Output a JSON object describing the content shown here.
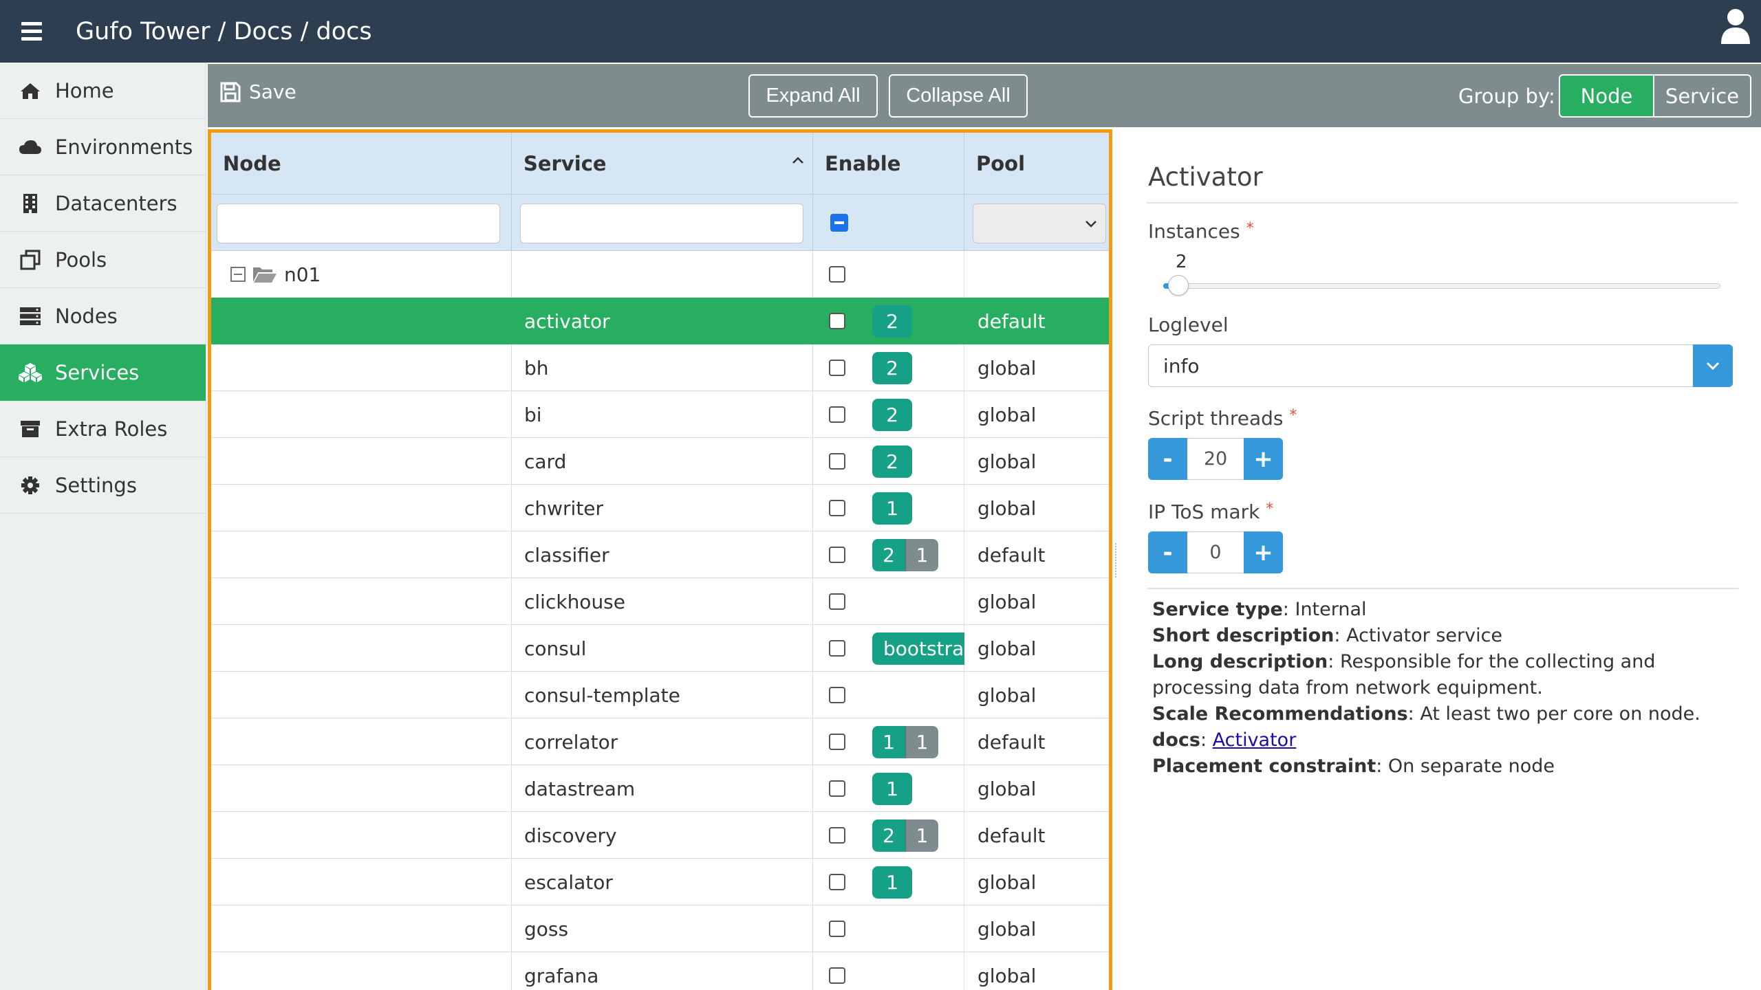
{
  "app": {
    "title": "Gufo Tower / Docs / docs"
  },
  "sidebar": {
    "items": [
      {
        "label": "Home",
        "icon": "home-icon"
      },
      {
        "label": "Environments",
        "icon": "cloud-icon"
      },
      {
        "label": "Datacenters",
        "icon": "building-icon"
      },
      {
        "label": "Pools",
        "icon": "clone-icon"
      },
      {
        "label": "Nodes",
        "icon": "server-icon"
      },
      {
        "label": "Services",
        "icon": "cubes-icon",
        "active": true
      },
      {
        "label": "Extra Roles",
        "icon": "archive-icon"
      },
      {
        "label": "Settings",
        "icon": "gear-icon"
      }
    ]
  },
  "toolbar": {
    "save_label": "Save",
    "expand_all": "Expand All",
    "collapse_all": "Collapse All",
    "group_by_label": "Group by:",
    "group_node": "Node",
    "group_service": "Service",
    "group_selected": "Node"
  },
  "grid": {
    "columns": [
      "Node",
      "Service",
      "Enable",
      "Pool"
    ],
    "sorted_column": "Service",
    "group_row": {
      "node": "n01"
    },
    "rows": [
      {
        "service": "activator",
        "badges": [
          "2"
        ],
        "pool": "default",
        "selected": true
      },
      {
        "service": "bh",
        "badges": [
          "2"
        ],
        "pool": "global"
      },
      {
        "service": "bi",
        "badges": [
          "2"
        ],
        "pool": "global"
      },
      {
        "service": "card",
        "badges": [
          "2"
        ],
        "pool": "global"
      },
      {
        "service": "chwriter",
        "badges": [
          "1"
        ],
        "pool": "global"
      },
      {
        "service": "classifier",
        "badges": [
          "2",
          "1"
        ],
        "pool": "default"
      },
      {
        "service": "clickhouse",
        "badges": [],
        "pool": "global"
      },
      {
        "service": "consul",
        "badges": [
          "bootstrap"
        ],
        "pool": "global"
      },
      {
        "service": "consul-template",
        "badges": [],
        "pool": "global"
      },
      {
        "service": "correlator",
        "badges": [
          "1",
          "1"
        ],
        "pool": "default"
      },
      {
        "service": "datastream",
        "badges": [
          "1"
        ],
        "pool": "global"
      },
      {
        "service": "discovery",
        "badges": [
          "2",
          "1"
        ],
        "pool": "default"
      },
      {
        "service": "escalator",
        "badges": [
          "1"
        ],
        "pool": "global"
      },
      {
        "service": "goss",
        "badges": [],
        "pool": "global"
      },
      {
        "service": "grafana",
        "badges": [],
        "pool": "global"
      }
    ]
  },
  "panel": {
    "title": "Activator",
    "instances_label": "Instances",
    "instances_value": "2",
    "instances_fraction": 0.02,
    "loglevel_label": "Loglevel",
    "loglevel_value": "info",
    "script_threads_label": "Script threads",
    "script_threads_value": "20",
    "tos_label": "IP ToS mark",
    "tos_value": "0",
    "stepper_minus": "-",
    "stepper_plus": "+",
    "required_mark": "*",
    "info": [
      {
        "key": "Service type",
        "value": "Internal"
      },
      {
        "key": "Short description",
        "value": "Activator service"
      },
      {
        "key": "Long description",
        "value": "Responsible for the collecting and processing data from network equipment."
      },
      {
        "key": "Scale Recommendations",
        "value": "At least two per core on node."
      },
      {
        "key": "docs",
        "value": "Activator",
        "link": true
      },
      {
        "key": "Placement constraint",
        "value": "On separate node"
      }
    ]
  },
  "colors": {
    "topbar": "#2c3e50",
    "accent_green": "#27ae60",
    "badge_teal": "#16a085",
    "badge_gray": "#7f8c8d",
    "grid_border": "#f39c12",
    "blue": "#3498db"
  }
}
